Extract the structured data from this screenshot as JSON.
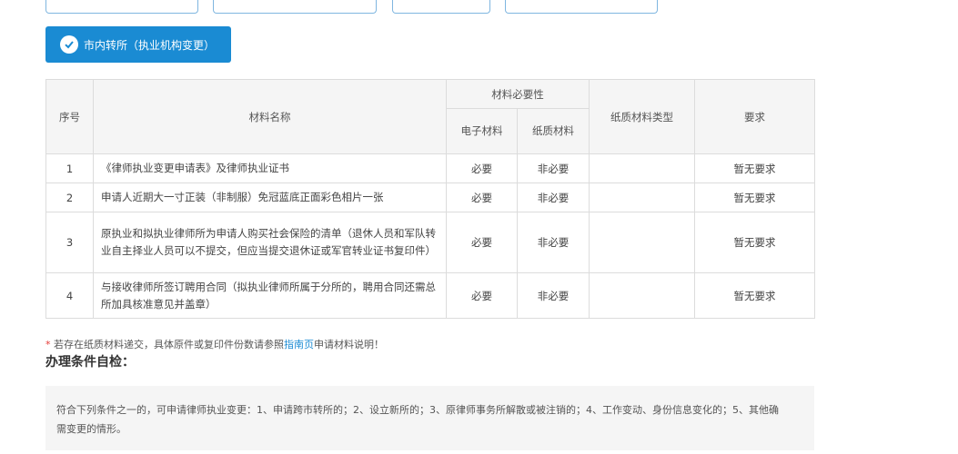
{
  "option_button": {
    "label": "市内转所（执业机构变更）"
  },
  "table": {
    "headers": {
      "index": "序号",
      "name": "材料名称",
      "necessity": "材料必要性",
      "electronic": "电子材料",
      "paper": "纸质材料",
      "paper_type": "纸质材料类型",
      "requirement": "要求"
    },
    "rows": [
      {
        "index": "1",
        "name": "《律师执业变更申请表》及律师执业证书",
        "electronic": "必要",
        "paper": "非必要",
        "paper_type": "",
        "requirement": "暂无要求"
      },
      {
        "index": "2",
        "name": "申请人近期大一寸正装（非制服）免冠蓝底正面彩色相片一张",
        "electronic": "必要",
        "paper": "非必要",
        "paper_type": "",
        "requirement": "暂无要求"
      },
      {
        "index": "3",
        "name": "原执业和拟执业律师所为申请人购买社会保险的清单（退休人员和军队转业自主择业人员可以不提交，但应当提交退休证或军官转业证书复印件）",
        "electronic": "必要",
        "paper": "非必要",
        "paper_type": "",
        "requirement": "暂无要求"
      },
      {
        "index": "4",
        "name": "与接收律师所签订聘用合同（拟执业律师所属于分所的，聘用合同还需总所加具核准意见并盖章）",
        "electronic": "必要",
        "paper": "非必要",
        "paper_type": "",
        "requirement": "暂无要求"
      }
    ]
  },
  "note": {
    "star": "*",
    "text_before": "若存在纸质材料递交，具体原件或复印件份数请参照",
    "link": "指南页",
    "text_after": "申请材料说明！"
  },
  "section_title": "办理条件自检：",
  "conditions_text": "符合下列条件之一的，可申请律师执业变更：1、申请跨市转所的；2、设立新所的；3、原律师事务所解散或被注销的；4、工作变动、身份信息变化的；5、其他确需变更的情形。",
  "colors": {
    "accent": "#1a8bd3",
    "header_bg": "#f5f5f5",
    "border": "#dcdcdc",
    "required_star": "#e53935"
  },
  "icons": {
    "option_check": "check-circle-icon"
  }
}
